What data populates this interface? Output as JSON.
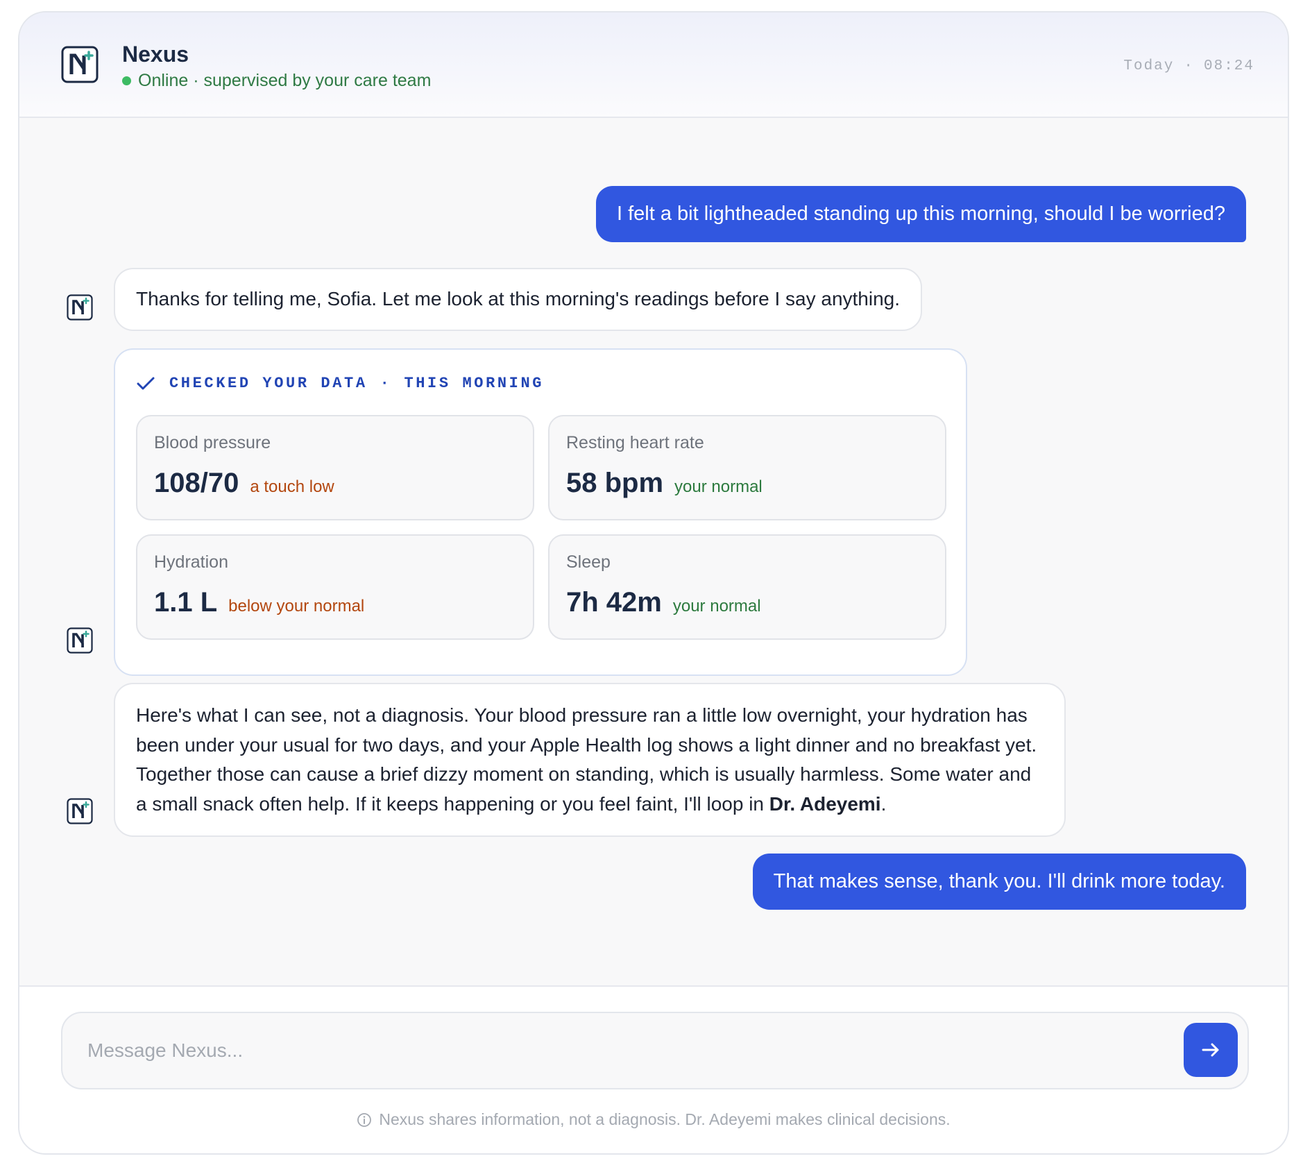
{
  "header": {
    "app_name": "Nexus",
    "status": "Online · supervised by your care team",
    "timestamp_day": "Today",
    "timestamp_sep": "·",
    "timestamp_time": "08:24"
  },
  "messages": {
    "user_1": "I felt a bit lightheaded standing up this morning, should I be worried?",
    "bot_1": "Thanks for telling me, Sofia. Let me look at this morning's readings before I say anything.",
    "bot_2_part1": "Here's what I can see, not a diagnosis. Your blood pressure ran a little low overnight, your hydration has been under your usual for two days, and your Apple Health log shows a light dinner and no breakfast yet. Together those can cause a brief dizzy moment on standing, which is usually harmless. Some water and a small snack often help. If it keeps happening or you feel faint, I'll loop in ",
    "bot_2_bold": "Dr. Adeyemi",
    "bot_2_end": ".",
    "user_2": "That makes sense, thank you. I'll drink more today."
  },
  "data_card": {
    "title": "CHECKED YOUR DATA",
    "sep": "·",
    "when": "THIS MORNING",
    "metrics": [
      {
        "label": "Blood pressure",
        "value": "108/70",
        "note": "a touch low",
        "status": "warn"
      },
      {
        "label": "Resting heart rate",
        "value": "58 bpm",
        "note": "your normal",
        "status": "ok"
      },
      {
        "label": "Hydration",
        "value": "1.1 L",
        "note": "below your normal",
        "status": "warn"
      },
      {
        "label": "Sleep",
        "value": "7h 42m",
        "note": "your normal",
        "status": "ok"
      }
    ]
  },
  "composer": {
    "placeholder": "Message Nexus...",
    "value": ""
  },
  "disclaimer": "Nexus shares information, not a diagnosis. Dr. Adeyemi makes clinical decisions.",
  "colors": {
    "accent": "#3157e0",
    "online": "#3dbb63",
    "warn": "#b3470f",
    "ok": "#2c7a3e",
    "logo_navy": "#1c2a44",
    "logo_teal": "#3aa99a"
  },
  "icons": {
    "logo": "nexus-logo-icon",
    "check": "check-icon",
    "send": "arrow-right-icon",
    "info": "info-icon"
  }
}
